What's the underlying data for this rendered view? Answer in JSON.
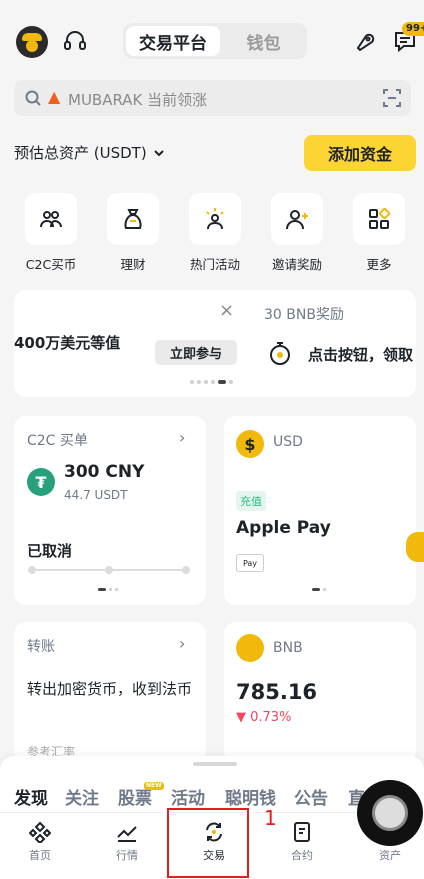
{
  "header": {
    "segment_active": "交易平台",
    "segment_inactive": "钱包",
    "notification_badge": "99+"
  },
  "search": {
    "placeholder": "MUBARAK 当前领涨"
  },
  "assets": {
    "label": "预估总资产 (USDT)",
    "add_funds": "添加资金"
  },
  "quick_actions": [
    {
      "label": "C2C买币",
      "icon": "c2c-users-icon"
    },
    {
      "label": "理财",
      "icon": "money-bag-icon"
    },
    {
      "label": "热门活动",
      "icon": "sparkle-person-icon"
    },
    {
      "label": "邀请奖励",
      "icon": "invite-user-icon"
    },
    {
      "label": "更多",
      "icon": "grid-more-icon"
    }
  ],
  "banner": {
    "left_text": "400万美元等值",
    "join_label": "立即参与",
    "close_symbol": "×",
    "right_title": "30 BNB奖励",
    "right_text": "点击按钮，领取"
  },
  "c2c_card": {
    "title": "C2C 买单",
    "amount": "300 CNY",
    "sub_amount": "44.7 USDT",
    "status": "已取消"
  },
  "usd_card": {
    "coin": "USD",
    "coin_symbol": "$",
    "tag": "充值",
    "method": "Apple Pay",
    "method_logo": "Pay"
  },
  "transfer_card": {
    "title": "转账",
    "desc": "转出加密货币，收到法币",
    "ref": "参考汇率"
  },
  "bnb_card": {
    "coin": "BNB",
    "price": "785.16",
    "change": "▼ 0.73%"
  },
  "feed_tabs": [
    "发现",
    "关注",
    "股票",
    "活动",
    "聪明钱",
    "公告",
    "直播"
  ],
  "feed_new_badge": "NEW",
  "bottom_nav": [
    "首页",
    "行情",
    "交易",
    "合约",
    "资产"
  ],
  "annotation_number": "1",
  "colors": {
    "brand": "#f0b90b",
    "button": "#fcd535",
    "down": "#f6465d",
    "up": "#2ebd85",
    "highlight": "#e02020"
  }
}
